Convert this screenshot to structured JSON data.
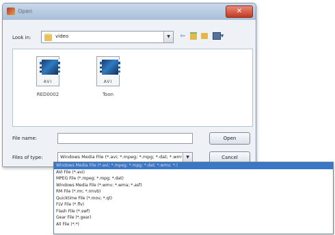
{
  "window": {
    "title": "Open",
    "close_label": "✕"
  },
  "lookin": {
    "label": "Look in:",
    "value": "video"
  },
  "toolbar": {
    "back_label": "⇦",
    "views_label": "▾"
  },
  "files": [
    {
      "name": "RED0002",
      "ext": "AVI"
    },
    {
      "name": "Toon",
      "ext": "AVI"
    }
  ],
  "filename": {
    "label": "File name:",
    "value": ""
  },
  "filetype": {
    "label": "Files of type:",
    "value": "Windows Media File (*.avi; *.mpeg; *.mpg; *.dat; *.wmv; *.)"
  },
  "buttons": {
    "open": "Open",
    "cancel": "Cancel"
  },
  "dropdown": {
    "items": [
      "Windows Media File (*.avi; *.mpeg; *.mpg; *.dat; *.wmv; *.)",
      "AVI File (*.avi)",
      "MPEG File (*.mpeg; *.mpg; *.dat)",
      "Windows Media File (*.wmv; *.wma; *.asf)",
      "RM File (*.rm; *.rmvb)",
      "Quicktime File (*.mov; *.qt)",
      "FLV File (*.flv)",
      "Flash File (*.swf)",
      "Gear File (*.gear)",
      "All File (*.*)"
    ],
    "selected_index": 0
  }
}
